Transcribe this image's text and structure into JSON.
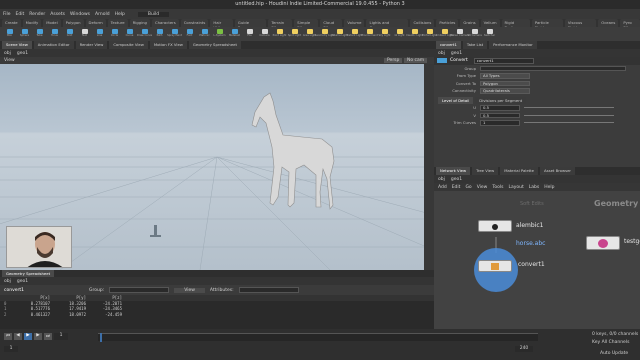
{
  "window": {
    "title": "untitled.hip - Houdini Indie Limited-Commercial 19.0.455 - Python 3"
  },
  "menubar": [
    "File",
    "Edit",
    "Render",
    "Assets",
    "Windows",
    "Arnold",
    "Help"
  ],
  "desktop": "Build",
  "shelf_tabs": [
    "Create",
    "Modify",
    "Model",
    "Polygon",
    "Deform",
    "Texture",
    "Rigging",
    "Characters",
    "Constraints",
    "Hair Utils",
    "Guide Process",
    "Terrain FX",
    "Simple FX",
    "Cloud FX",
    "Volume",
    "Lights and Cameras",
    "Collisions",
    "Particles",
    "Grains",
    "Vellum",
    "Rigid Bodies",
    "Particle Fluids",
    "Viscous Fluids",
    "Oceans",
    "Pyro FX"
  ],
  "tools": [
    {
      "label": "Box",
      "color": "#4aa0d8"
    },
    {
      "label": "Sphere",
      "color": "#4aa0d8"
    },
    {
      "label": "Tube",
      "color": "#4aa0d8"
    },
    {
      "label": "Torus",
      "color": "#4aa0d8"
    },
    {
      "label": "Grid",
      "color": "#4aa0d8"
    },
    {
      "label": "Null",
      "color": "#d8d8d8"
    },
    {
      "label": "Line",
      "color": "#4aa0d8"
    },
    {
      "label": "Circle",
      "color": "#4aa0d8"
    },
    {
      "label": "Curve",
      "color": "#4aa0d8"
    },
    {
      "label": "Draw Curve",
      "color": "#4aa0d8"
    },
    {
      "label": "Path",
      "color": "#4aa0d8"
    },
    {
      "label": "Spray Paint",
      "color": "#4aa0d8"
    },
    {
      "label": "Font",
      "color": "#4aa0d8"
    },
    {
      "label": "Platonic",
      "color": "#4aa0d8"
    },
    {
      "label": "L-System",
      "color": "#7bc043"
    },
    {
      "label": "Metaball",
      "color": "#4aa0d8"
    },
    {
      "label": "File",
      "color": "#d8d8d8"
    },
    {
      "label": "Camera",
      "color": "#d8d8d8"
    },
    {
      "label": "Point Light",
      "color": "#f0d060"
    },
    {
      "label": "Spot Light",
      "color": "#f0d060"
    },
    {
      "label": "Area Light",
      "color": "#f0d060"
    },
    {
      "label": "Geometry Light",
      "color": "#f0d060"
    },
    {
      "label": "Volume Light",
      "color": "#f0d060"
    },
    {
      "label": "Distant Light",
      "color": "#f0d060"
    },
    {
      "label": "Environment",
      "color": "#f0d060"
    },
    {
      "label": "Sky Light",
      "color": "#f0d060"
    },
    {
      "label": "GI Light",
      "color": "#f0d060"
    },
    {
      "label": "Caustic Light",
      "color": "#f0d060"
    },
    {
      "label": "Portal Light",
      "color": "#f0d060"
    },
    {
      "label": "Ambient Light",
      "color": "#f0d060"
    },
    {
      "label": "Stereo Camera",
      "color": "#d8d8d8"
    },
    {
      "label": "VR Camera",
      "color": "#d8d8d8"
    },
    {
      "label": "Switcher",
      "color": "#d8d8d8"
    }
  ],
  "left_tabs": [
    "Scene View",
    "Animation Editor",
    "Render View",
    "Composite View",
    "Motion FX View",
    "Geometry Spreadsheet"
  ],
  "path": {
    "obj": "obj",
    "node": "geo1"
  },
  "viewer": {
    "tab": "View",
    "persp": "Persp",
    "cam": "No cam"
  },
  "spreadsheet": {
    "tab": "Geometry Spreadsheet",
    "node": "convert1",
    "group_label": "Group:",
    "view_label": "View",
    "attr_label": "Attributes:",
    "columns": [
      "",
      "P[x]",
      "P[y]",
      "P[z]"
    ],
    "rows": [
      [
        "0",
        "0.278107",
        "18.3206",
        "-24.2071"
      ],
      [
        "1",
        "0.517776",
        "17.9419",
        "-24.3465"
      ],
      [
        "2",
        "0.461327",
        "18.0972",
        "-24.459"
      ]
    ]
  },
  "playbar": {
    "frame": "1",
    "start": "1",
    "end": "240",
    "keys": "0 keys, 0/0 channels",
    "key_all": "Key All Channels",
    "auto_update": "Auto Update"
  },
  "right_tabs": [
    "convert1",
    "Take List",
    "Performance Monitor"
  ],
  "params": {
    "title": "Convert",
    "node_name": "convert1",
    "rows": [
      {
        "label": "Group",
        "value": ""
      },
      {
        "label": "From Type",
        "value": "All Types"
      },
      {
        "label": "Convert To",
        "value": "Polygon"
      },
      {
        "label": "Connectivity",
        "value": "Quadrilaterals"
      }
    ],
    "lod_tabs": [
      "Level of Detail",
      "Divisions per Segment"
    ],
    "uvw": [
      {
        "label": "U",
        "value": "0.5"
      },
      {
        "label": "V",
        "value": "0.5"
      },
      {
        "label": "Trim Curves",
        "value": "1"
      }
    ]
  },
  "network_tabs": [
    "Network View",
    "Tree View",
    "Material Palette",
    "Asset Browser"
  ],
  "network_menu": [
    "Add",
    "Edit",
    "Go",
    "View",
    "Tools",
    "Layout",
    "Labs",
    "Help"
  ],
  "network": {
    "context": "Geometry",
    "hint": "Soft Edits",
    "nodes": [
      {
        "name": "alembic1",
        "sub": "horse.abc"
      },
      {
        "name": "convert1",
        "sub": ""
      },
      {
        "name": "testgeometry",
        "sub": ""
      }
    ]
  }
}
